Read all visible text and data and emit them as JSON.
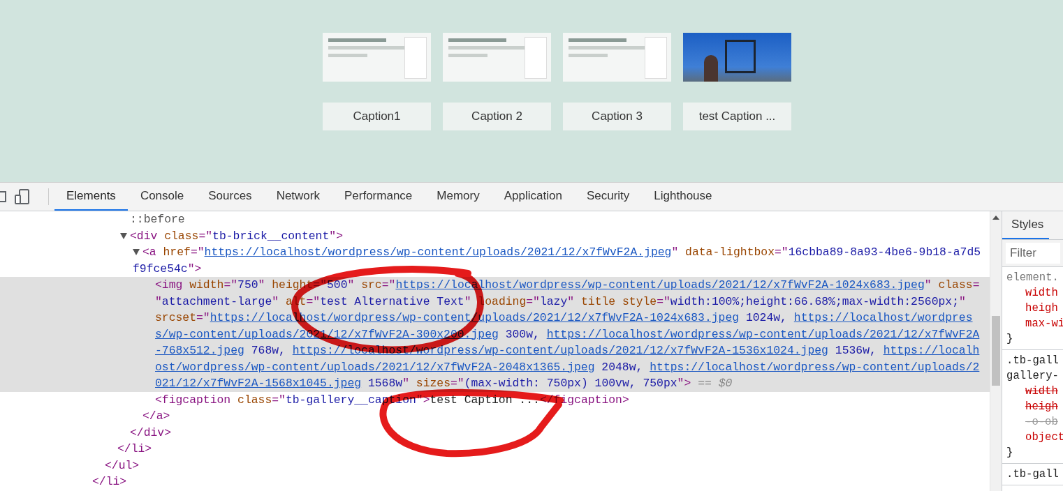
{
  "gallery": [
    {
      "kind": "screenshot",
      "caption": "Caption1"
    },
    {
      "kind": "screenshot",
      "caption": "Caption 2"
    },
    {
      "kind": "screenshot",
      "caption": "Caption 3"
    },
    {
      "kind": "photo",
      "caption": "test Caption ..."
    }
  ],
  "devtools": {
    "tabs": [
      {
        "label": "Elements",
        "selected": true
      },
      {
        "label": "Console",
        "selected": false
      },
      {
        "label": "Sources",
        "selected": false
      },
      {
        "label": "Network",
        "selected": false
      },
      {
        "label": "Performance",
        "selected": false
      },
      {
        "label": "Memory",
        "selected": false
      },
      {
        "label": "Application",
        "selected": false
      },
      {
        "label": "Security",
        "selected": false
      },
      {
        "label": "Lighthouse",
        "selected": false
      }
    ],
    "dom_tree": [
      {
        "selected": false,
        "close": [
          {
            "kind": "tag",
            "text": "</li>"
          }
        ],
        "children": [
          {
            "selected": false,
            "close": [
              {
                "kind": "tag",
                "text": "</ul>"
              }
            ],
            "children": [
              {
                "selected": false,
                "close": [
                  {
                    "kind": "tag",
                    "text": "</li>"
                  }
                ],
                "children": [
                  {
                    "selected": false,
                    "open": [
                      [
                        {
                          "kind": "pseudo",
                          "text": "::before"
                        }
                      ]
                    ]
                  },
                  {
                    "selected": false,
                    "expanded": true,
                    "open": [
                      [
                        {
                          "kind": "tag",
                          "text": "<div"
                        },
                        {
                          "kind": "attr",
                          "text": " class"
                        },
                        {
                          "kind": "tag",
                          "text": "=\""
                        },
                        {
                          "kind": "val",
                          "text": "tb-brick__content"
                        },
                        {
                          "kind": "tag",
                          "text": "\">"
                        }
                      ]
                    ],
                    "close": [
                      {
                        "kind": "tag",
                        "text": "</div>"
                      }
                    ],
                    "children": [
                      {
                        "selected": false,
                        "expanded": true,
                        "open": [
                          [
                            {
                              "kind": "tag",
                              "text": "<a"
                            },
                            {
                              "kind": "attr",
                              "text": " href"
                            },
                            {
                              "kind": "tag",
                              "text": "=\""
                            },
                            {
                              "kind": "link",
                              "text": "https://localhost/wordpress/wp-content/uploads/2021/12/x7fWvF2A.jpeg"
                            },
                            {
                              "kind": "tag",
                              "text": "\""
                            },
                            {
                              "kind": "attr",
                              "text": " data-lightbox"
                            },
                            {
                              "kind": "tag",
                              "text": "=\""
                            },
                            {
                              "kind": "val",
                              "text": "16cbba89-8a93-4be6-9b18-a7d5"
                            }
                          ],
                          [
                            {
                              "kind": "val",
                              "text": "f9fce54c"
                            },
                            {
                              "kind": "tag",
                              "text": "\">"
                            }
                          ]
                        ],
                        "close": [
                          {
                            "kind": "tag",
                            "text": "</a>"
                          }
                        ],
                        "children": [
                          {
                            "selected": true,
                            "open": [
                              [
                                {
                                  "kind": "tag",
                                  "text": "<img"
                                },
                                {
                                  "kind": "attr",
                                  "text": " width"
                                },
                                {
                                  "kind": "tag",
                                  "text": "=\""
                                },
                                {
                                  "kind": "val",
                                  "text": "750"
                                },
                                {
                                  "kind": "tag",
                                  "text": "\""
                                },
                                {
                                  "kind": "attr",
                                  "text": " height"
                                },
                                {
                                  "kind": "tag",
                                  "text": "=\""
                                },
                                {
                                  "kind": "val",
                                  "text": "500"
                                },
                                {
                                  "kind": "tag",
                                  "text": "\""
                                },
                                {
                                  "kind": "attr",
                                  "text": " src"
                                },
                                {
                                  "kind": "tag",
                                  "text": "=\""
                                },
                                {
                                  "kind": "link",
                                  "text": "https://localhost/wordpress/wp-content/uploads/2021/12/x7fWvF2A-1024x683.jpeg"
                                },
                                {
                                  "kind": "tag",
                                  "text": "\""
                                },
                                {
                                  "kind": "attr",
                                  "text": " class"
                                },
                                {
                                  "kind": "tag",
                                  "text": "="
                                }
                              ],
                              [
                                {
                                  "kind": "tag",
                                  "text": "\""
                                },
                                {
                                  "kind": "val",
                                  "text": "attachment-large"
                                },
                                {
                                  "kind": "tag",
                                  "text": "\""
                                },
                                {
                                  "kind": "attr",
                                  "text": " alt"
                                },
                                {
                                  "kind": "tag",
                                  "text": "=\""
                                },
                                {
                                  "kind": "val",
                                  "text": "test Alternative Text"
                                },
                                {
                                  "kind": "tag",
                                  "text": "\""
                                },
                                {
                                  "kind": "attr",
                                  "text": " loading"
                                },
                                {
                                  "kind": "tag",
                                  "text": "=\""
                                },
                                {
                                  "kind": "val",
                                  "text": "lazy"
                                },
                                {
                                  "kind": "tag",
                                  "text": "\""
                                },
                                {
                                  "kind": "attr",
                                  "text": " title style"
                                },
                                {
                                  "kind": "tag",
                                  "text": "=\""
                                },
                                {
                                  "kind": "val",
                                  "text": "width:100%;height:66.68%;max-width:2560px;"
                                },
                                {
                                  "kind": "tag",
                                  "text": "\""
                                }
                              ],
                              [
                                {
                                  "kind": "attr",
                                  "text": "srcset"
                                },
                                {
                                  "kind": "tag",
                                  "text": "=\""
                                },
                                {
                                  "kind": "link",
                                  "text": "https://localhost/wordpress/wp-content/uploads/2021/12/x7fWvF2A-1024x683.jpeg"
                                },
                                {
                                  "kind": "val",
                                  "text": " 1024w, "
                                },
                                {
                                  "kind": "link",
                                  "text": "https://localhost/wordpres"
                                }
                              ],
                              [
                                {
                                  "kind": "link",
                                  "text": "s/wp-content/uploads/2021/12/x7fWvF2A-300x200.jpeg"
                                },
                                {
                                  "kind": "val",
                                  "text": " 300w, "
                                },
                                {
                                  "kind": "link",
                                  "text": "https://localhost/wordpress/wp-content/uploads/2021/12/x7fWvF2A"
                                }
                              ],
                              [
                                {
                                  "kind": "link",
                                  "text": "-768x512.jpeg"
                                },
                                {
                                  "kind": "val",
                                  "text": " 768w, "
                                },
                                {
                                  "kind": "link",
                                  "text": "https://localhost/wordpress/wp-content/uploads/2021/12/x7fWvF2A-1536x1024.jpeg"
                                },
                                {
                                  "kind": "val",
                                  "text": " 1536w, "
                                },
                                {
                                  "kind": "link",
                                  "text": "https://localh"
                                }
                              ],
                              [
                                {
                                  "kind": "link",
                                  "text": "ost/wordpress/wp-content/uploads/2021/12/x7fWvF2A-2048x1365.jpeg"
                                },
                                {
                                  "kind": "val",
                                  "text": " 2048w, "
                                },
                                {
                                  "kind": "link",
                                  "text": "https://localhost/wordpress/wp-content/uploads/2"
                                }
                              ],
                              [
                                {
                                  "kind": "link",
                                  "text": "021/12/x7fWvF2A-1568x1045.jpeg"
                                },
                                {
                                  "kind": "val",
                                  "text": " 1568w"
                                },
                                {
                                  "kind": "tag",
                                  "text": "\""
                                },
                                {
                                  "kind": "attr",
                                  "text": " sizes"
                                },
                                {
                                  "kind": "tag",
                                  "text": "=\""
                                },
                                {
                                  "kind": "val",
                                  "text": "(max-width: 750px) 100vw, 750px"
                                },
                                {
                                  "kind": "tag",
                                  "text": "\">"
                                },
                                {
                                  "kind": "dim",
                                  "text": " == $0"
                                }
                              ]
                            ]
                          },
                          {
                            "selected": false,
                            "open": [
                              [
                                {
                                  "kind": "tag",
                                  "text": "<figcaption"
                                },
                                {
                                  "kind": "attr",
                                  "text": " class"
                                },
                                {
                                  "kind": "tag",
                                  "text": "=\""
                                },
                                {
                                  "kind": "val",
                                  "text": "tb-gallery__caption"
                                },
                                {
                                  "kind": "tag",
                                  "text": "\">"
                                },
                                {
                                  "kind": "text",
                                  "text": "test Caption ..."
                                },
                                {
                                  "kind": "tag",
                                  "text": "</figcaption>"
                                }
                              ]
                            ]
                          }
                        ]
                      }
                    ]
                  }
                ]
              }
            ]
          }
        ]
      }
    ],
    "styles_pane": {
      "tabs": [
        {
          "label": "Styles",
          "selected": true
        }
      ],
      "filter": {
        "placeholder": "Filter"
      },
      "rules": [
        {
          "selector": [
            "element."
          ],
          "props": [
            {
              "kind": "active",
              "text": "width"
            },
            {
              "kind": "active",
              "text": "heigh"
            },
            {
              "kind": "active",
              "text": "max-wi"
            }
          ],
          "close": "}"
        },
        {
          "selector": [
            ".tb-gall",
            "gallery-"
          ],
          "props": [
            {
              "kind": "overridden",
              "text": "width"
            },
            {
              "kind": "overridden",
              "text": "heigh"
            },
            {
              "kind": "inactive",
              "text": "-o-ob"
            },
            {
              "kind": "active",
              "text": "object"
            }
          ],
          "close": "}"
        },
        {
          "selector": [
            ".tb-gall"
          ]
        }
      ]
    }
  }
}
